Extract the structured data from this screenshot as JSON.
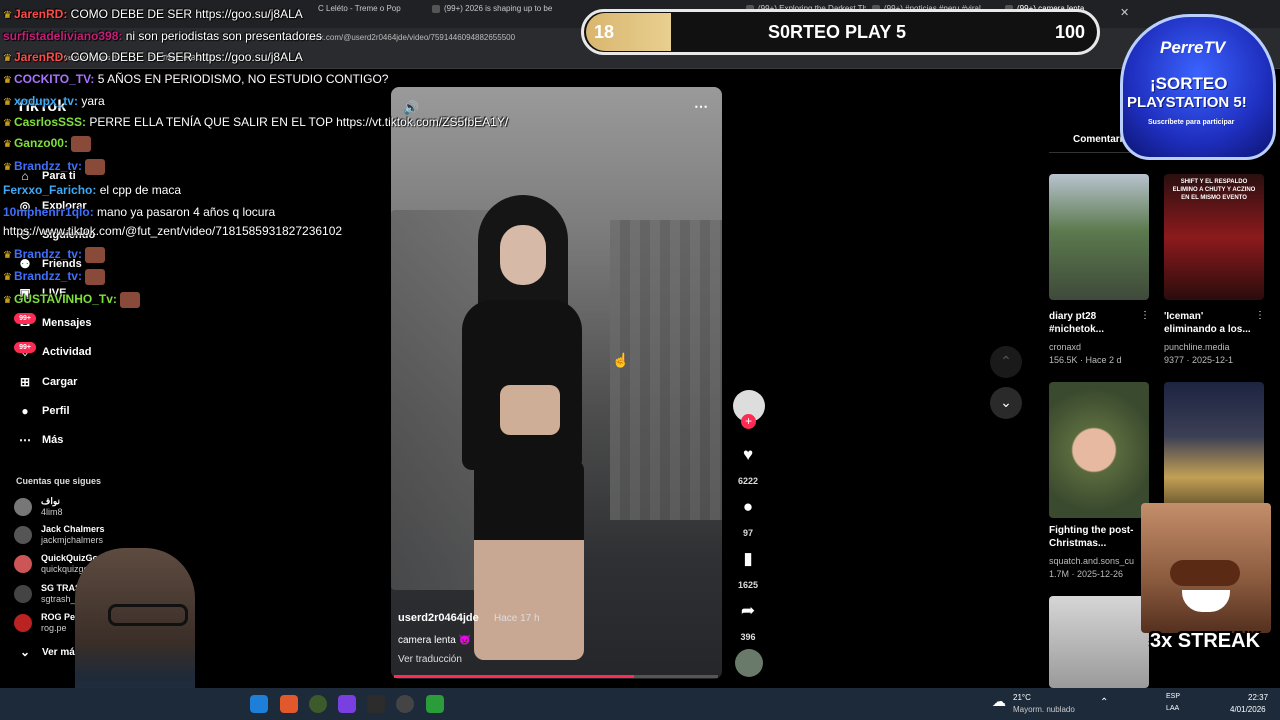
{
  "browser": {
    "tabs": [
      "Perre.xlsx - Hojas de...",
      "The Thing • HBO Max",
      "(99+) 2026 is shaping up to be",
      "(99+) Exploring the Darkest Th...",
      "(99+) #noticias #peru #viral",
      "(99+) camera lenta"
    ],
    "tab_partial_1": "C Leléto - Treme o Pop",
    "tab_partial_2": "Handsom",
    "url": "tiktok.com/@userd2r0464jde/video/7591446094882655500"
  },
  "score_banner": {
    "left_value": "18",
    "title": "S0RTEO PLAY 5",
    "right_value": "100"
  },
  "perretv": {
    "name": "PerreTV",
    "headline_1": "¡SORTEO",
    "headline_2": "PLAYSTATION 5!",
    "subtitle": "Suscríbete para participar"
  },
  "chat": [
    {
      "user": "JarenRD:",
      "text": " COMO DEBE DE SER https://goo.su/j8ALA",
      "color": "#ff4a4a",
      "crown": true
    },
    {
      "user": "surfistadeliviano398:",
      "text": " ni son periodistas son presentadores",
      "color": "#c41f7a",
      "crown": false
    },
    {
      "user": "JarenRD:",
      "text": " COMO DEBE DE SER https://goo.su/j8ALA",
      "color": "#ff4a4a",
      "crown": true
    },
    {
      "user": "COCKITO_TV:",
      "text": " 5 AÑOS EN PERIODISMO, NO ESTUDIO CONTIGO?",
      "color": "#a873ff",
      "crown": true
    },
    {
      "user": "xodupx_tv:",
      "text": " yara",
      "color": "#3fa9f5",
      "crown": true
    },
    {
      "user": "CasrlosSSS:",
      "text": " PERRE ELLA TENÍA QUE SALIR EN EL TOP https://vt.tiktok.com/ZS5fbEA1Y/",
      "color": "#7ee03a",
      "crown": true
    },
    {
      "user": "Ganzo00:",
      "text": "",
      "color": "#7ee03a",
      "crown": true
    },
    {
      "user": "Brandzz_tv:",
      "text": "",
      "color": "#3f6fff",
      "crown": true
    },
    {
      "user": "Ferxxo_Faricho:",
      "text": " el cpp de maca",
      "color": "#3fa9f5",
      "crown": false
    },
    {
      "user": "10mphenrr1qlo:",
      "text": " mano ya pasaron 4 años q locura",
      "color": "#3f6fff",
      "crown": false
    },
    {
      "user": "",
      "text": "https://www.tiktok.com/@fut_zent/video/7181585931827236102",
      "color": "#ffffff",
      "crown": false
    },
    {
      "user": "Brandzz_tv:",
      "text": "",
      "color": "#3f6fff",
      "crown": true
    },
    {
      "user": "Brandzz_tv:",
      "text": "",
      "color": "#3f6fff",
      "crown": true
    },
    {
      "user": "GUSTAVINHO_Tv:",
      "text": "",
      "color": "#7ee03a",
      "crown": true
    }
  ],
  "sidebar": {
    "logo": "TikTok",
    "items": [
      {
        "label": "Para ti",
        "icon": "home-icon"
      },
      {
        "label": "Explorar",
        "icon": "compass-icon"
      },
      {
        "label": "Siguiendo",
        "icon": "following-icon"
      },
      {
        "label": "Friends",
        "icon": "friends-icon"
      },
      {
        "label": "LIVE",
        "icon": "live-icon"
      },
      {
        "label": "Mensajes",
        "icon": "messages-icon",
        "badge": "99+"
      },
      {
        "label": "Actividad",
        "icon": "activity-icon",
        "badge": "99+"
      },
      {
        "label": "Cargar",
        "icon": "upload-icon"
      },
      {
        "label": "Perfil",
        "icon": "profile-icon"
      },
      {
        "label": "Más",
        "icon": "more-icon"
      }
    ],
    "following_title": "Cuentas que sigues",
    "following": [
      {
        "name": "نواف",
        "handle": "4lim8",
        "color": "#777"
      },
      {
        "name": "Jack Chalmers",
        "handle": "jackmjchalmers",
        "color": "#555"
      },
      {
        "name": "QuickQuizGo",
        "handle": "quickquizgo",
        "color": "#c55"
      },
      {
        "name": "SG TRASH",
        "handle": "sgtrash_",
        "color": "#444"
      },
      {
        "name": "ROG Per",
        "handle": "rog.pe",
        "color": "#b22"
      }
    ],
    "see_more": "Ver más"
  },
  "video": {
    "author": "userd2r0464jde",
    "time": "Hace 17 h",
    "caption": "camera lenta 😈",
    "translate": "Ver traducción",
    "progress": 0.74
  },
  "rail": {
    "likes": "6222",
    "comments": "97",
    "saves": "1625",
    "shares": "396"
  },
  "right_panel": {
    "tab": "Comentarios",
    "videos": [
      {
        "title": "diary pt28 #nichetok...",
        "author": "cronaxd",
        "meta": "156.5K · Hace 2 d"
      },
      {
        "title": "'Iceman' eliminando a los...",
        "author": "punchline.media",
        "meta": "9377 · 2025-12-1"
      },
      {
        "title": "Fighting the post-Christmas...",
        "author": "squatch.and.sons_cu",
        "meta": "1.7M · 2025-12-26"
      },
      {
        "title": "",
        "author": "",
        "meta": ""
      }
    ],
    "thumb2_text": "SHIFT Y EL RESPALDO ELIMINO A CHUTY Y ACZINO EN EL MISMO EVENTO"
  },
  "overlay": {
    "streak": "3x STREAK"
  },
  "taskbar": {
    "weather_temp": "21°C",
    "weather_desc": "Mayorm. nublado",
    "lang_1": "ESP",
    "lang_2": "LAA",
    "time": "22:37",
    "date": "4/01/2026"
  }
}
